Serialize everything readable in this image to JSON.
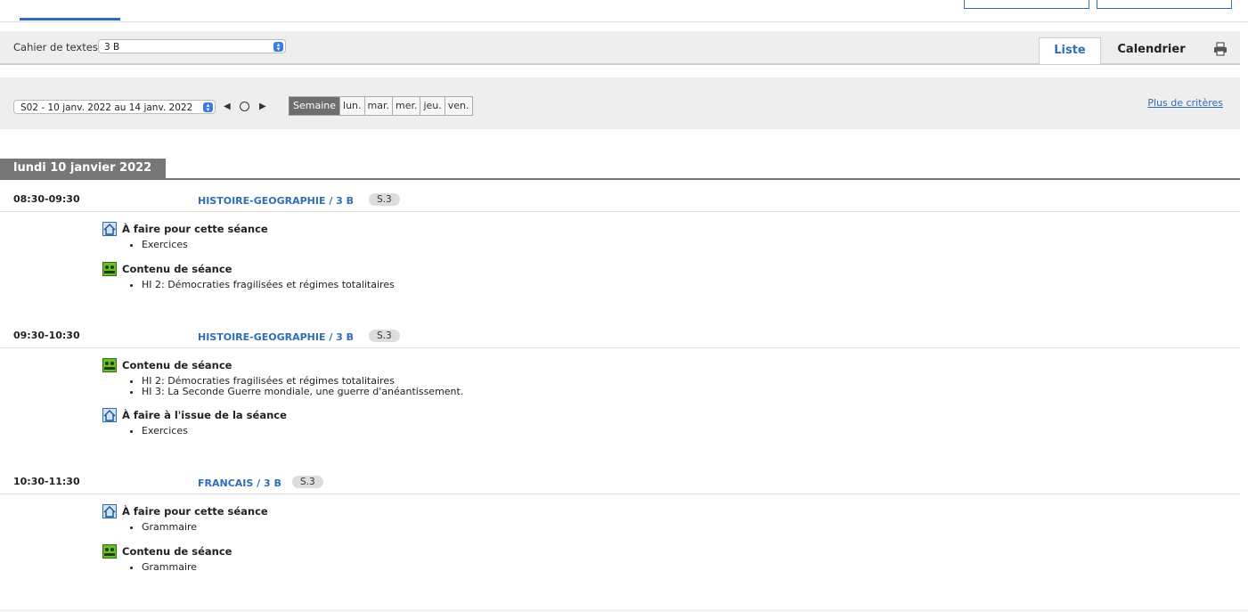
{
  "cahier": {
    "label": "Cahier de textes",
    "selected": "3 B"
  },
  "view_tabs": {
    "liste": "Liste",
    "calendrier": "Calendrier",
    "print_icon": "printer-icon"
  },
  "week": {
    "selected": "S02 - 10 janv. 2022 au 14 janv. 2022",
    "days": [
      "Semaine",
      "lun.",
      "mar.",
      "mer.",
      "jeu.",
      "ven."
    ],
    "active_day": "Semaine",
    "more_criteria": "Plus de critères"
  },
  "day_header": "lundi 10 janvier 2022",
  "sessions": [
    {
      "time": "08:30-09:30",
      "subject": "HISTOIRE-GEOGRAPHIE / 3 B",
      "room": "S.3",
      "blocks": [
        {
          "icon": "homework-icon",
          "title": "À faire pour cette séance",
          "items": [
            "Exercices"
          ]
        },
        {
          "icon": "lesson-content-icon",
          "title": "Contenu de séance",
          "items": [
            "HI 2: Démocraties fragilisées et régimes totalitaires"
          ]
        }
      ]
    },
    {
      "time": "09:30-10:30",
      "subject": "HISTOIRE-GEOGRAPHIE / 3 B",
      "room": "S.3",
      "blocks": [
        {
          "icon": "lesson-content-icon",
          "title": "Contenu de séance",
          "items": [
            "HI 2: Démocraties fragilisées et régimes totalitaires",
            "HI 3: La Seconde Guerre mondiale, une guerre d'anéantissement."
          ]
        },
        {
          "icon": "homework-icon",
          "title": "À faire à l'issue de la séance",
          "items": [
            "Exercices"
          ]
        }
      ]
    },
    {
      "time": "10:30-11:30",
      "subject": "FRANCAIS / 3 B",
      "room": "S.3",
      "blocks": [
        {
          "icon": "homework-icon",
          "title": "À faire pour cette séance",
          "items": [
            "Grammaire"
          ]
        },
        {
          "icon": "lesson-content-icon",
          "title": "Contenu de séance",
          "items": [
            "Grammaire"
          ]
        }
      ]
    }
  ],
  "colors": {
    "accent": "#2f6eb5",
    "day_header_bg": "#777777",
    "content_icon": "#6bbf2a"
  }
}
